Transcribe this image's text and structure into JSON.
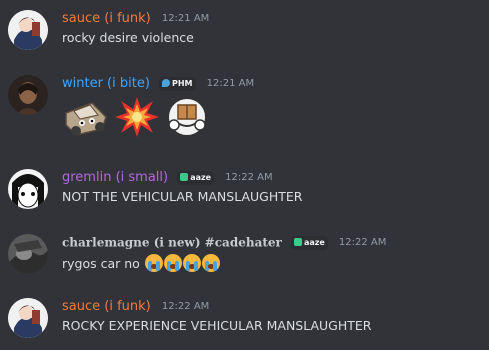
{
  "messages": [
    {
      "author": "sauce (i funk)",
      "author_color": "#f47b3b",
      "time": "12:21 AM",
      "text": "rocky desire violence"
    },
    {
      "author": "winter (i bite)",
      "author_color": "#3ea6ff",
      "time": "12:21 AM",
      "badge": "PHM",
      "emojis": [
        "car-emoji",
        "collision-emoji",
        "package-emoji"
      ]
    },
    {
      "author": "gremlin (i small)",
      "author_color": "#b36ad9",
      "time": "12:22 AM",
      "badge": "aaze",
      "text": "NOT THE VEHICULAR MANSLAUGHTER"
    },
    {
      "author": "charlemagne (i new) #cadehater",
      "author_color": "#c9ccd1",
      "time": "12:22 AM",
      "badge": "aaze",
      "text": "rygos car no",
      "trailing_emojis": [
        "sob-emoji",
        "sob-emoji",
        "sob-emoji",
        "sob-emoji"
      ]
    },
    {
      "author": "sauce (i funk)",
      "author_color": "#f47b3b",
      "time": "12:22 AM",
      "text": "ROCKY EXPERIENCE VEHICULAR MANSLAUGHTER"
    }
  ]
}
